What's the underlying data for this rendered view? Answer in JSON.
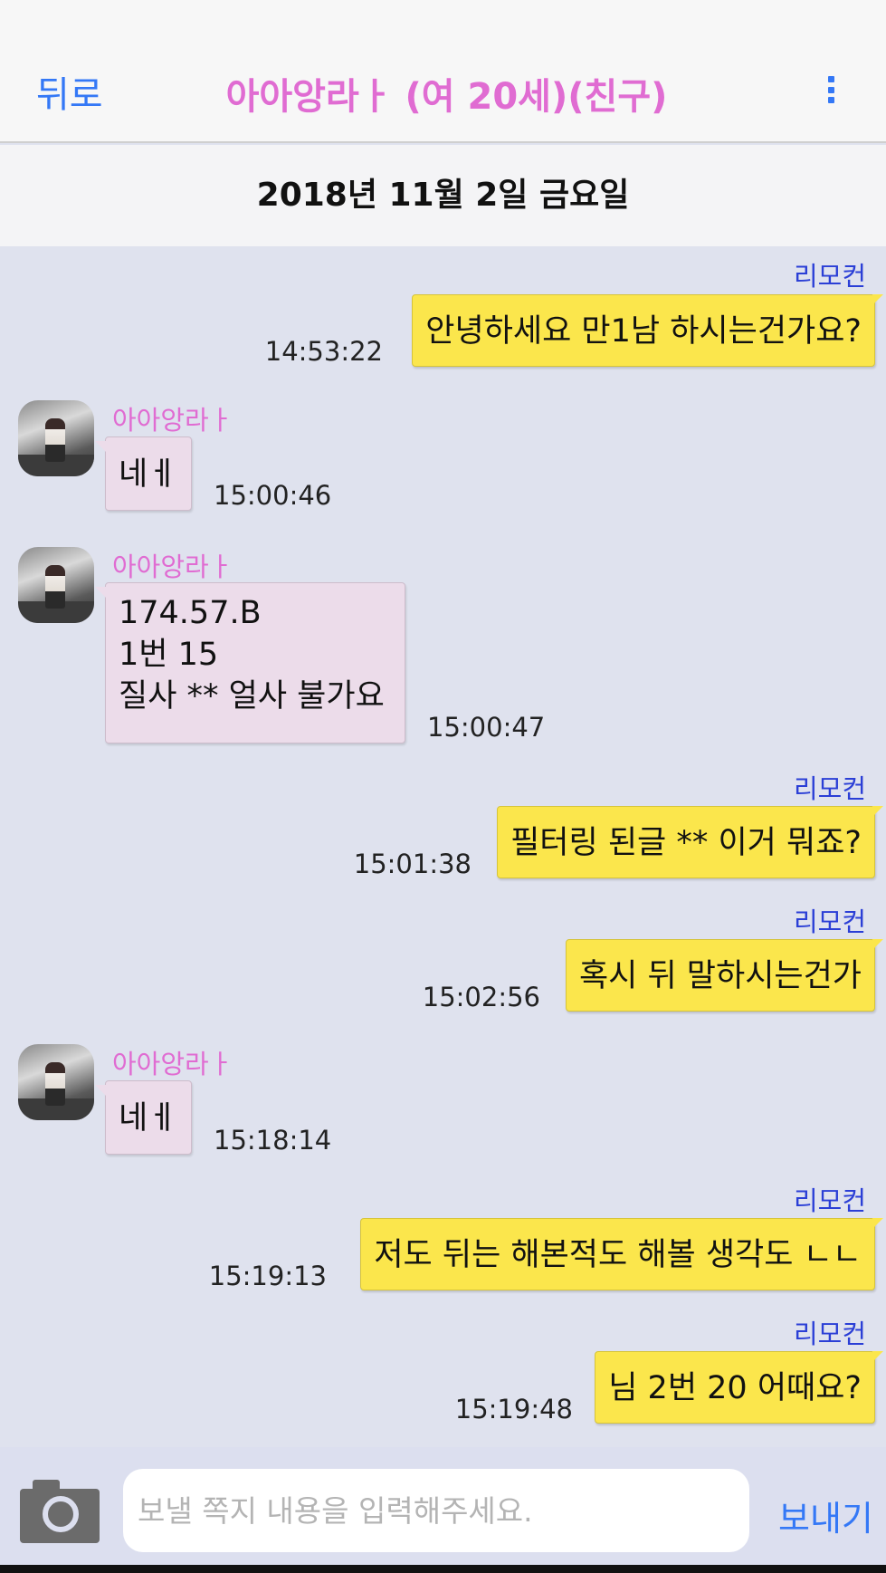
{
  "header": {
    "back_label": "뒤로",
    "title": "아아앙라ㅏ  (여 20세)(친구)",
    "menu_icon": "more-vertical-icon"
  },
  "date_separator": "2018년 11월 2일 금요일",
  "colors": {
    "outgoing_bubble": "#fbe64c",
    "incoming_bubble": "#ecdcea",
    "accent_blue": "#3478f6",
    "name_pink": "#e06cd2",
    "name_blue": "#2b3fd6"
  },
  "messages": [
    {
      "direction": "out",
      "sender": "리모컨",
      "lines": [
        "안녕하세요 만1남 하시는건가요?"
      ],
      "time": "14:53:22"
    },
    {
      "direction": "in",
      "sender": "아아앙라ㅏ",
      "lines": [
        "네ㅔ"
      ],
      "time": "15:00:46"
    },
    {
      "direction": "in",
      "sender": "아아앙라ㅏ",
      "lines": [
        "174.57.B",
        "1번 15",
        "질사 ** 얼사 불가요"
      ],
      "time": "15:00:47"
    },
    {
      "direction": "out",
      "sender": "리모컨",
      "lines": [
        "필터링 된글 ** 이거 뭐죠?"
      ],
      "time": "15:01:38"
    },
    {
      "direction": "out",
      "sender": "리모컨",
      "lines": [
        "혹시 뒤 말하시는건가"
      ],
      "time": "15:02:56"
    },
    {
      "direction": "in",
      "sender": "아아앙라ㅏ",
      "lines": [
        "네ㅔ"
      ],
      "time": "15:18:14"
    },
    {
      "direction": "out",
      "sender": "리모컨",
      "lines": [
        "저도 뒤는 해본적도 해볼 생각도 ㄴㄴ"
      ],
      "time": "15:19:13"
    },
    {
      "direction": "out",
      "sender": "리모컨",
      "lines": [
        "님 2번 20 어때요?"
      ],
      "time": "15:19:48"
    }
  ],
  "input_bar": {
    "camera_icon": "camera-icon",
    "placeholder": "보낼 쪽지 내용을 입력해주세요.",
    "value": "",
    "send_label": "보내기"
  }
}
